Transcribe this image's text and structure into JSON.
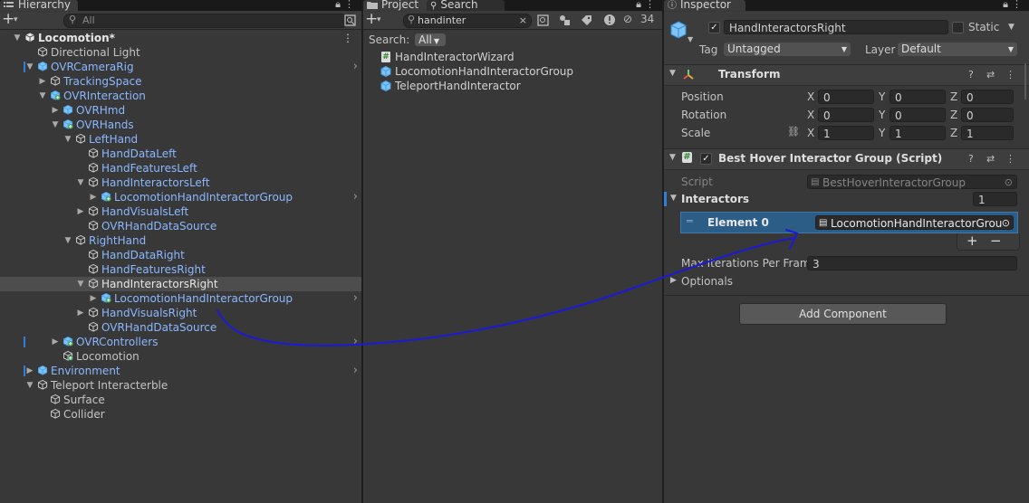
{
  "hierarchy": {
    "tab_label": "Hierarchy",
    "search_placeholder": "All",
    "rows": [
      {
        "label": "Locomotion*",
        "indent": 0,
        "fold": "open",
        "icon": "unity-scene-icon",
        "bold": true,
        "menu": true
      },
      {
        "label": "Directional Light",
        "indent": 1,
        "icon": "gameobject-icon"
      },
      {
        "label": "OVRCameraRig",
        "indent": 1,
        "fold": "open",
        "icon": "prefab-icon",
        "blue": true,
        "bar": true,
        "arrow": true
      },
      {
        "label": "TrackingSpace",
        "indent": 2,
        "fold": "closed",
        "icon": "gameobject-icon",
        "blue": true
      },
      {
        "label": "OVRInteraction",
        "indent": 2,
        "fold": "open",
        "icon": "prefab-added-icon",
        "blue": true
      },
      {
        "label": "OVRHmd",
        "indent": 3,
        "fold": "closed",
        "icon": "prefab-icon",
        "blue": true
      },
      {
        "label": "OVRHands",
        "indent": 3,
        "fold": "open",
        "icon": "prefab-added-icon",
        "blue": true
      },
      {
        "label": "LeftHand",
        "indent": 4,
        "fold": "open",
        "icon": "gameobject-icon",
        "blue": true
      },
      {
        "label": "HandDataLeft",
        "indent": 5,
        "icon": "gameobject-icon",
        "blue": true
      },
      {
        "label": "HandFeaturesLeft",
        "indent": 5,
        "icon": "gameobject-icon",
        "blue": true
      },
      {
        "label": "HandInteractorsLeft",
        "indent": 5,
        "fold": "open",
        "icon": "gameobject-icon",
        "blue": true
      },
      {
        "label": "LocomotionHandInteractorGroup",
        "indent": 6,
        "fold": "closed",
        "icon": "prefab-added-icon",
        "blue": true,
        "arrow": true
      },
      {
        "label": "HandVisualsLeft",
        "indent": 5,
        "fold": "closed",
        "icon": "gameobject-icon",
        "blue": true
      },
      {
        "label": "OVRHandDataSource",
        "indent": 5,
        "icon": "gameobject-icon",
        "blue": true
      },
      {
        "label": "RightHand",
        "indent": 4,
        "fold": "open",
        "icon": "gameobject-icon",
        "blue": true
      },
      {
        "label": "HandDataRight",
        "indent": 5,
        "icon": "gameobject-icon",
        "blue": true
      },
      {
        "label": "HandFeaturesRight",
        "indent": 5,
        "icon": "gameobject-icon",
        "blue": true
      },
      {
        "label": "HandInteractorsRight",
        "indent": 5,
        "fold": "open",
        "icon": "gameobject-icon",
        "selected": true
      },
      {
        "label": "LocomotionHandInteractorGroup",
        "indent": 6,
        "fold": "closed",
        "icon": "prefab-added-icon",
        "blue": true,
        "arrow": true
      },
      {
        "label": "HandVisualsRight",
        "indent": 5,
        "fold": "closed",
        "icon": "gameobject-icon",
        "blue": true
      },
      {
        "label": "OVRHandDataSource",
        "indent": 5,
        "icon": "gameobject-icon",
        "blue": true
      },
      {
        "label": "OVRControllers",
        "indent": 3,
        "fold": "closed",
        "icon": "prefab-added-icon",
        "blue": true,
        "bar": true,
        "arrow": true
      },
      {
        "label": "Locomotion",
        "indent": 3,
        "icon": "gameobject-added-icon"
      },
      {
        "label": "Environment",
        "indent": 1,
        "fold": "closed",
        "icon": "prefab-icon",
        "blue": true,
        "bar": true,
        "arrow": true
      },
      {
        "label": "Teleport Interacterble",
        "indent": 1,
        "fold": "open",
        "icon": "gameobject-icon"
      },
      {
        "label": "Surface",
        "indent": 2,
        "icon": "gameobject-icon"
      },
      {
        "label": "Collider",
        "indent": 2,
        "icon": "gameobject-icon"
      }
    ]
  },
  "project": {
    "tab_project": "Project",
    "tab_search": "Search",
    "search_value": "handinter",
    "hidden_count": "34",
    "search_label": "Search:",
    "search_scope": "All",
    "results": [
      {
        "label": "HandInteractorWizard",
        "icon": "script-icon"
      },
      {
        "label": "LocomotionHandInteractorGroup",
        "icon": "prefab-icon"
      },
      {
        "label": "TeleportHandInteractor",
        "icon": "prefab-icon"
      }
    ]
  },
  "inspector": {
    "tab_label": "Inspector",
    "object_name": "HandInteractorsRight",
    "static_label": "Static",
    "tag_label": "Tag",
    "tag_value": "Untagged",
    "layer_label": "Layer",
    "layer_value": "Default",
    "transform": {
      "title": "Transform",
      "rows": [
        {
          "label": "Position",
          "x": "0",
          "y": "0",
          "z": "0"
        },
        {
          "label": "Rotation",
          "x": "0",
          "y": "0",
          "z": "0"
        },
        {
          "label": "Scale",
          "x": "1",
          "y": "1",
          "z": "1"
        }
      ],
      "axes": [
        "X",
        "Y",
        "Z"
      ]
    },
    "component": {
      "title": "Best Hover Interactor Group (Script)",
      "script_label": "Script",
      "script_value": "BestHoverInteractorGroup",
      "interactors_label": "Interactors",
      "interactors_count": "1",
      "element_label": "Element 0",
      "element_value": "LocomotionHandInteractorGrou",
      "max_label": "Max Iterations Per Frame",
      "max_value": "3",
      "optionals_label": "Optionals"
    },
    "add_component_label": "Add Component"
  },
  "annotation": {
    "stroke_color": "#1a1ad8"
  }
}
